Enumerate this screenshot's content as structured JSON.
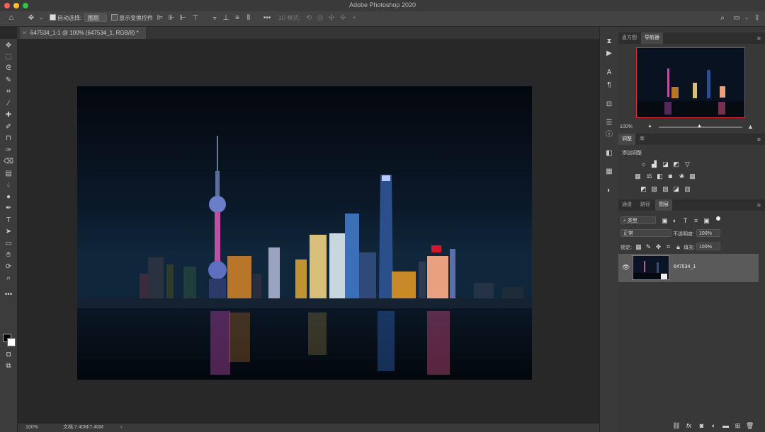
{
  "window": {
    "title": "Adobe Photoshop 2020"
  },
  "options_bar": {
    "auto_select_label": "自动选择:",
    "auto_select_value": "图层",
    "show_transform_label": "显示变换控件",
    "mode_3d_label": "3D 模式:",
    "more_label": "•••"
  },
  "document": {
    "tab_title": "647534_1-1 @ 100% (647534_1, RGB/8) *",
    "close_glyph": "×"
  },
  "status_bar": {
    "zoom": "100%",
    "doc_size": "文档:7.40M/7.40M",
    "arrow": "›"
  },
  "navigator_panel": {
    "tabs": [
      "直方图",
      "导航器"
    ],
    "active_tab": "导航器",
    "zoom": "100%"
  },
  "adjustments_panel": {
    "tabs": [
      "调整",
      "库"
    ],
    "active_tab": "调整",
    "heading": "添加调整"
  },
  "layers_panel": {
    "tabs": [
      "通道",
      "路径",
      "图层"
    ],
    "active_tab": "图层",
    "filter_kind": "类型",
    "blend_mode": "正常",
    "opacity_label": "不透明度:",
    "opacity_value": "100%",
    "lock_label": "锁定:",
    "fill_label": "填充:",
    "fill_value": "100%",
    "layers": [
      {
        "name": "647534_1",
        "visible": true
      }
    ]
  },
  "colors": {
    "accent_red": "#d9343a",
    "panel_bg": "#383838",
    "canvas_bg": "#282828"
  }
}
